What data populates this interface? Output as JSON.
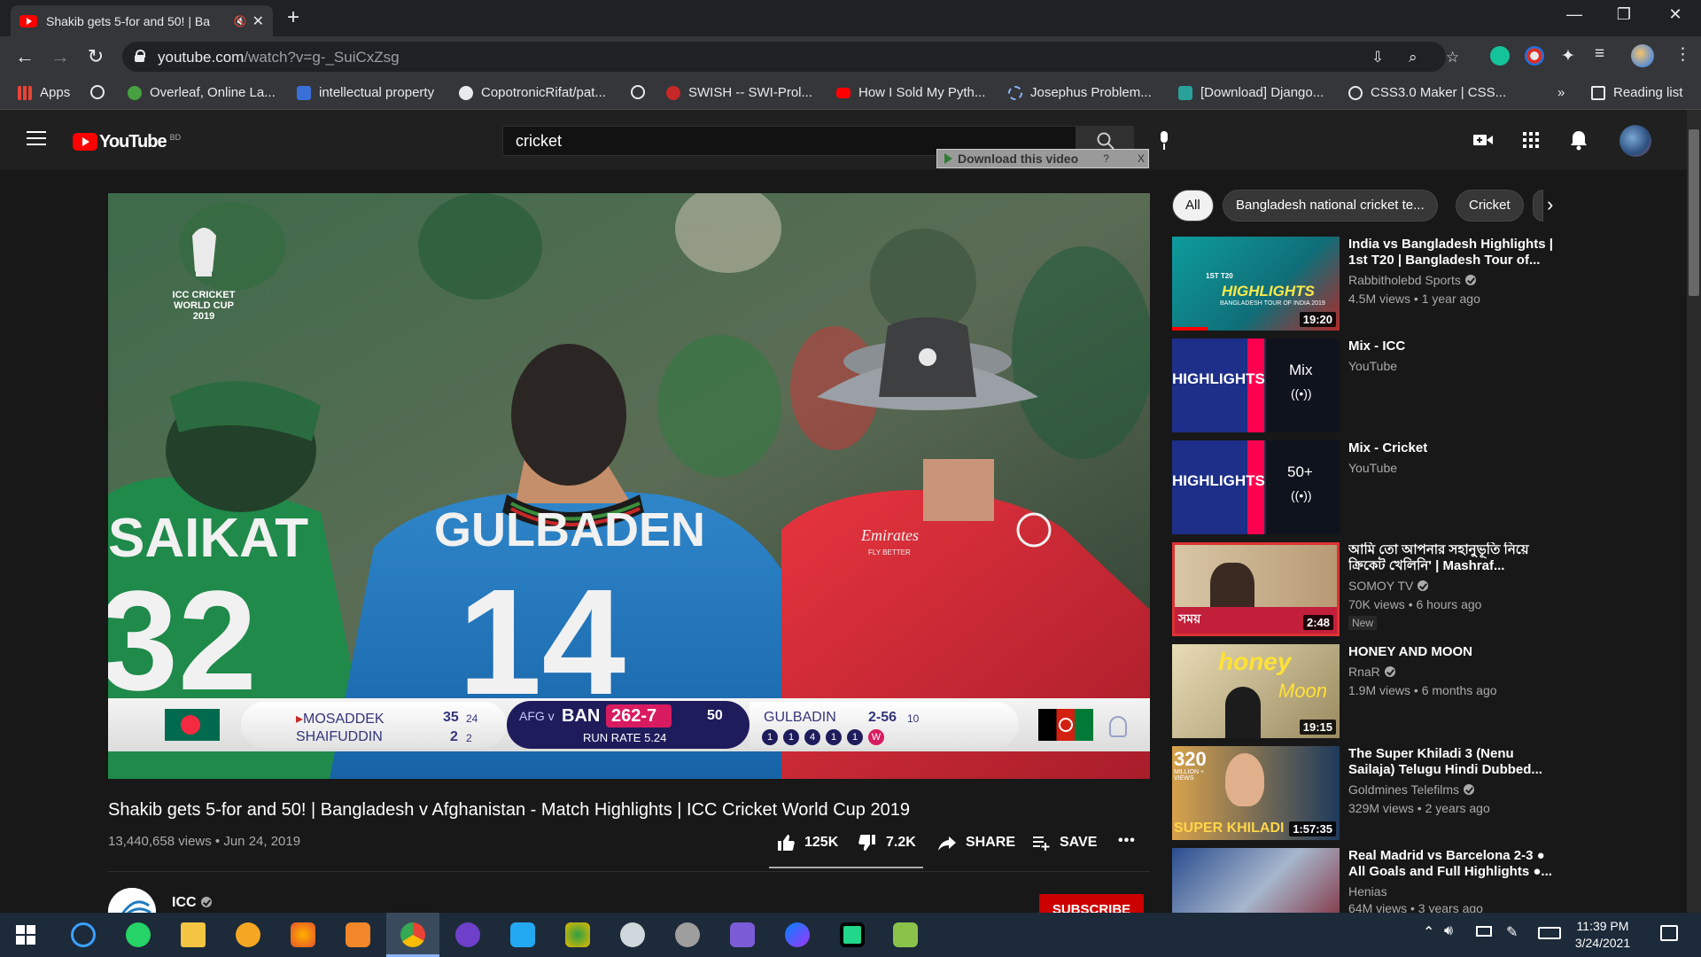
{
  "browser": {
    "tab_title": "Shakib gets 5-for and 50! | Ba",
    "url_host": "youtube.com",
    "url_path": "/watch?v=g-_SuiCxZsg",
    "bookmarks": [
      {
        "label": "Apps",
        "icon": "apps-grid-icon",
        "color": "#ea4335"
      },
      {
        "label": "",
        "icon": "globe-icon",
        "color": "#e8eaed"
      },
      {
        "label": "Overleaf, Online La...",
        "icon": "overleaf-icon",
        "color": "#47a141"
      },
      {
        "label": "intellectual property",
        "icon": "s-icon",
        "color": "#3b6fd8"
      },
      {
        "label": "CopotronicRifat/pat...",
        "icon": "github-icon",
        "color": "#e8eaed"
      },
      {
        "label": "",
        "icon": "globe-icon",
        "color": "#e8eaed"
      },
      {
        "label": "SWISH -- SWI-Prol...",
        "icon": "swish-icon",
        "color": "#c62828"
      },
      {
        "label": "How I Sold My Pyth...",
        "icon": "youtube-icon",
        "color": "#ff0000"
      },
      {
        "label": "Josephus Problem...",
        "icon": "spinner-icon",
        "color": "#8ab4f8"
      },
      {
        "label": "[Download] Django...",
        "icon": "django-icon",
        "color": "#2aa198"
      },
      {
        "label": "CSS3.0 Maker | CSS...",
        "icon": "globe-icon",
        "color": "#e8eaed"
      }
    ],
    "overflow_label": "»",
    "reading_list": "Reading list"
  },
  "youtube": {
    "logo_text": "YouTube",
    "country": "BD",
    "search_value": "cricket",
    "download_bar": "Download this video",
    "download_help": "?",
    "download_close": "X"
  },
  "video": {
    "overlay": {
      "wc_logo_line1": "ICC CRICKET",
      "wc_logo_line2": "WORLD CUP",
      "wc_logo_year": "2019",
      "jersey_left_name": "SAIKAT",
      "jersey_left_number": "32",
      "jersey_center_name": "GULBADEN",
      "jersey_center_number": "14",
      "umpire_sponsor": "Emirates",
      "umpire_sponsor_sub": "FLY BETTER"
    },
    "scorebar": {
      "batter1_name": "MOSADDEK",
      "batter1_runs": "35",
      "batter1_balls": "24",
      "batter2_name": "SHAIFUDDIN",
      "batter2_runs": "2",
      "batter2_balls": "2",
      "teams_prefix": "AFG v",
      "batting_team": "BAN",
      "score": "262-7",
      "overs": "50",
      "run_rate": "RUN RATE 5.24",
      "bowler_name": "GULBADIN",
      "bowler_figures": "2-56",
      "bowler_overs": "10",
      "balls": [
        "1",
        "1",
        "4",
        "1",
        "1",
        "W"
      ]
    },
    "title": "Shakib gets 5-for and 50! | Bangladesh v Afghanistan - Match Highlights | ICC Cricket World Cup 2019",
    "views": "13,440,658 views",
    "date": "Jun 24, 2019",
    "likes": "125K",
    "dislikes": "7.2K",
    "share": "SHARE",
    "save": "SAVE",
    "more": "•••",
    "channel": "ICC",
    "subscribe": "SUBSCRIBE"
  },
  "sidebar": {
    "chips": [
      "All",
      "Bangladesh national cricket te...",
      "Cricket"
    ],
    "cards": [
      {
        "title": "India vs Bangladesh Highlights | 1st T20 | Bangladesh Tour of...",
        "channel": "Rabbitholebd Sports",
        "verified": true,
        "views": "4.5M views • 1 year ago",
        "duration": "19:20",
        "thumb_text": "HIGHLIGHTS",
        "thumb_sub": "1ST T20",
        "thumb_caption": "BANGLADESH TOUR OF INDIA 2019",
        "badge": ""
      },
      {
        "title": "Mix - ICC",
        "channel": "YouTube",
        "verified": false,
        "views": "",
        "duration": "",
        "thumb_text": "HIGHLIGHTS",
        "thumb_sub": "Mix",
        "thumb_caption": "((•))",
        "badge": ""
      },
      {
        "title": "Mix - Cricket",
        "channel": "YouTube",
        "verified": false,
        "views": "",
        "duration": "",
        "thumb_text": "HIGHLIGHTS",
        "thumb_sub": "50+",
        "thumb_caption": "((•))",
        "badge": ""
      },
      {
        "title": "আমি তো আপনার সহানুভূতি নিয়ে ক্রিকেট খেলিনি' | Mashraf...",
        "channel": "SOMOY TV",
        "verified": true,
        "views": "70K views • 6 hours ago",
        "duration": "2:48",
        "thumb_text": "সময়",
        "thumb_sub": "",
        "thumb_caption": "",
        "badge": "New"
      },
      {
        "title": "HONEY AND MOON",
        "channel": "RnaR",
        "verified": true,
        "views": "1.9M views • 6 months ago",
        "duration": "19:15",
        "thumb_text": "honey",
        "thumb_sub": "Moon",
        "thumb_caption": "",
        "badge": ""
      },
      {
        "title": "The Super Khiladi 3 (Nenu Sailaja) Telugu Hindi Dubbed...",
        "channel": "Goldmines Telefilms",
        "verified": true,
        "views": "329M views • 2 years ago",
        "duration": "1:57:35",
        "thumb_text": "SUPER KHILADI",
        "thumb_sub": "320",
        "thumb_caption": "MILLION + VIEWS",
        "badge": ""
      },
      {
        "title": "Real Madrid vs Barcelona 2-3 ● All Goals and Full Highlights ●...",
        "channel": "Henias",
        "verified": false,
        "views": "64M views • 3 years ago",
        "duration": "",
        "thumb_text": "",
        "thumb_sub": "",
        "thumb_caption": "",
        "badge": ""
      }
    ]
  },
  "taskbar": {
    "time": "11:39 PM",
    "date": "3/24/2021"
  }
}
